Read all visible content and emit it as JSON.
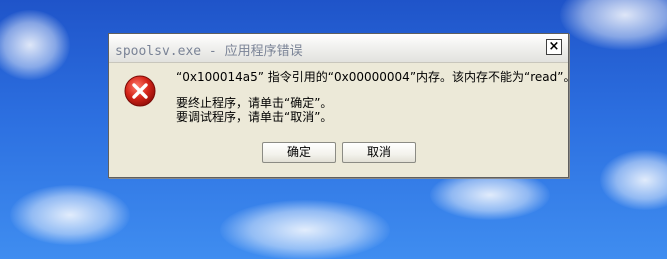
{
  "dialog": {
    "title": "spoolsv.exe - 应用程序错误",
    "close_label": "×",
    "icon": "error-icon",
    "messages": [
      "“0x100014a5” 指令引用的“0x00000004”内存。该内存不能为“read”。",
      "要终止程序，请单击“确定”。",
      "要调试程序，请单击“取消”。"
    ],
    "buttons": {
      "ok": "确定",
      "cancel": "取消"
    }
  },
  "colors": {
    "desktop_blue": "#2c6fe0",
    "dialog_bg": "#ece9d8",
    "error_red": "#c11b17"
  }
}
